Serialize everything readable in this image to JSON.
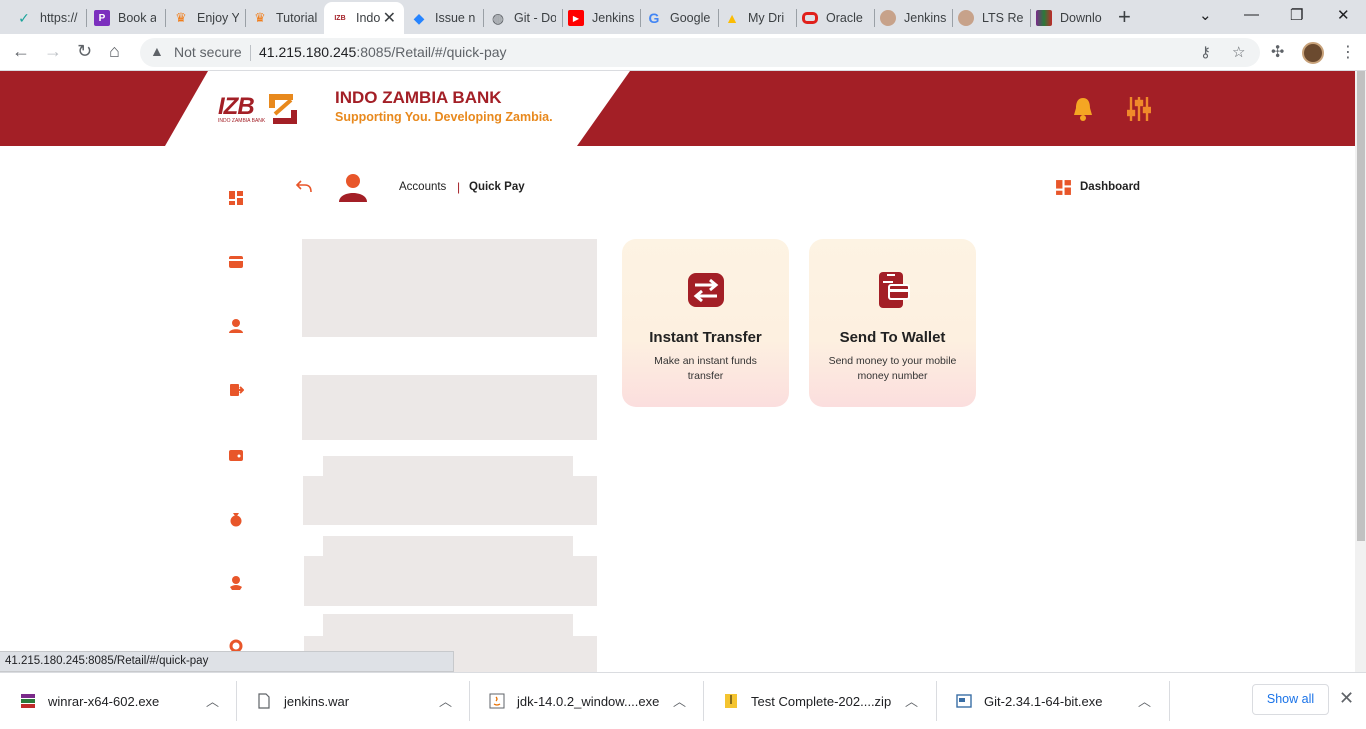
{
  "browser": {
    "tabs": [
      {
        "title": "https://",
        "icon": "tick-icon"
      },
      {
        "title": "Book a",
        "icon": "p-icon"
      },
      {
        "title": "Enjoy Y",
        "icon": "crown-icon"
      },
      {
        "title": "Tutorial",
        "icon": "crown-icon"
      },
      {
        "title": "Indo",
        "icon": "izb-icon"
      },
      {
        "title": "Issue n",
        "icon": "jira-icon"
      },
      {
        "title": "Git - Do",
        "icon": "globe-icon"
      },
      {
        "title": "Jenkins",
        "icon": "youtube-icon"
      },
      {
        "title": "Google",
        "icon": "google-icon"
      },
      {
        "title": "My Dri",
        "icon": "drive-icon"
      },
      {
        "title": "Oracle",
        "icon": "oracle-icon"
      },
      {
        "title": "Jenkins",
        "icon": "jenkins-icon"
      },
      {
        "title": "LTS Rel",
        "icon": "jenkins-icon"
      },
      {
        "title": "Downlo",
        "icon": "winrar-icon"
      }
    ],
    "address": {
      "security_label": "Not secure",
      "url_host": "41.215.180.245",
      "url_rest": ":8085/Retail/#/quick-pay"
    },
    "status_url": "41.215.180.245:8085/Retail/#/quick-pay",
    "downloads": [
      {
        "name": "winrar-x64-602.exe",
        "icon": "winrar-icon"
      },
      {
        "name": "jenkins.war",
        "icon": "file-icon"
      },
      {
        "name": "jdk-14.0.2_window....exe",
        "icon": "java-icon"
      },
      {
        "name": "Test Complete-202....zip",
        "icon": "zip-icon"
      },
      {
        "name": "Git-2.34.1-64-bit.exe",
        "icon": "installer-icon"
      }
    ],
    "show_all_label": "Show all"
  },
  "bank": {
    "logo_text": "IZB",
    "logo_sub": "INDO ZAMBIA BANK",
    "name": "INDO ZAMBIA BANK",
    "tagline": "Supporting You. Developing Zambia.",
    "colors": {
      "primary": "#a31f26",
      "accent": "#e8891d",
      "icon": "#e8562a"
    }
  },
  "breadcrumb": {
    "items": [
      "Accounts",
      "Quick Pay"
    ],
    "separator": "|"
  },
  "dashboard_label": "Dashboard",
  "cards": [
    {
      "title": "Instant Transfer",
      "description": "Make an instant funds transfer",
      "icon": "transfer-arrows-icon"
    },
    {
      "title": "Send To Wallet",
      "description": "Send money to your mobile money number",
      "icon": "wallet-phone-icon"
    }
  ]
}
